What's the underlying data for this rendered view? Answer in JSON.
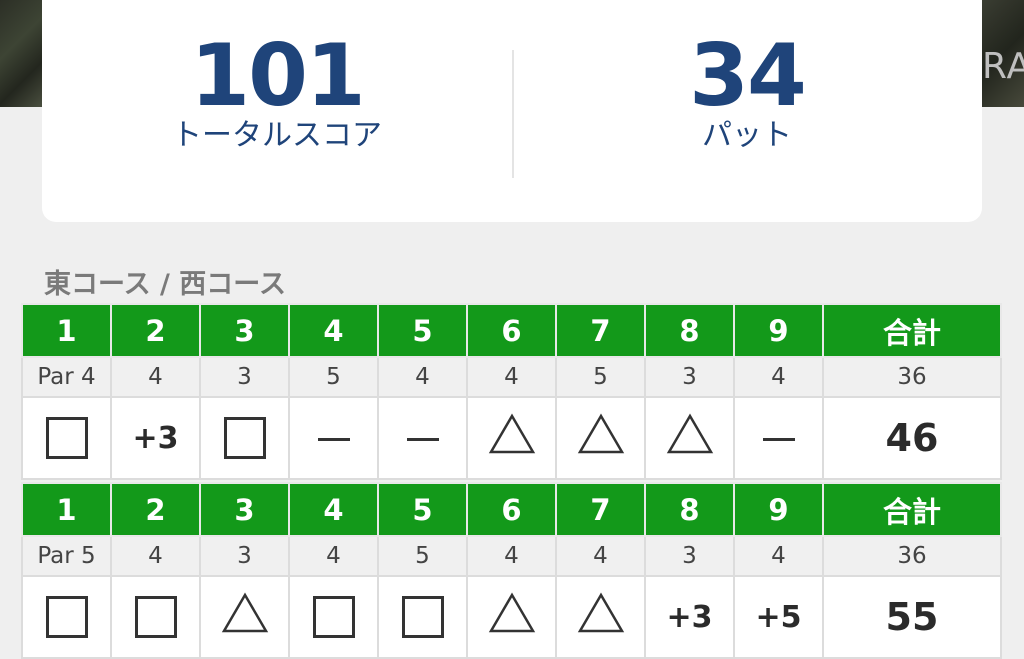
{
  "hero_overlay_text": "RA",
  "summary": {
    "total_score": "101",
    "total_score_label": "トータルスコア",
    "putts": "34",
    "putts_label": "パット"
  },
  "course_title": "東コース / 西コース",
  "rounds": [
    {
      "holes": [
        "1",
        "2",
        "3",
        "4",
        "5",
        "6",
        "7",
        "8",
        "9"
      ],
      "total_header": "合計",
      "par": [
        "Par 4",
        "4",
        "3",
        "5",
        "4",
        "4",
        "5",
        "3",
        "4"
      ],
      "par_total": "36",
      "results": [
        {
          "type": "square",
          "label": "square-icon"
        },
        {
          "type": "text",
          "value": "+3"
        },
        {
          "type": "square",
          "label": "square-icon"
        },
        {
          "type": "dash",
          "label": "dash-icon"
        },
        {
          "type": "dash",
          "label": "dash-icon"
        },
        {
          "type": "triangle",
          "label": "triangle-icon"
        },
        {
          "type": "triangle",
          "label": "triangle-icon"
        },
        {
          "type": "triangle",
          "label": "triangle-icon"
        },
        {
          "type": "dash",
          "label": "dash-icon"
        }
      ],
      "total": "46"
    },
    {
      "holes": [
        "1",
        "2",
        "3",
        "4",
        "5",
        "6",
        "7",
        "8",
        "9"
      ],
      "total_header": "合計",
      "par": [
        "Par 5",
        "4",
        "3",
        "4",
        "5",
        "4",
        "4",
        "3",
        "4"
      ],
      "par_total": "36",
      "results": [
        {
          "type": "square",
          "label": "square-icon"
        },
        {
          "type": "square",
          "label": "square-icon"
        },
        {
          "type": "triangle",
          "label": "triangle-icon"
        },
        {
          "type": "square",
          "label": "square-icon"
        },
        {
          "type": "square",
          "label": "square-icon"
        },
        {
          "type": "triangle",
          "label": "triangle-icon"
        },
        {
          "type": "triangle",
          "label": "triangle-icon"
        },
        {
          "type": "text",
          "value": "+3"
        },
        {
          "type": "text",
          "value": "+5"
        }
      ],
      "total": "55"
    }
  ],
  "colors": {
    "header_green": "#13991a",
    "score_blue": "#1f447a"
  }
}
